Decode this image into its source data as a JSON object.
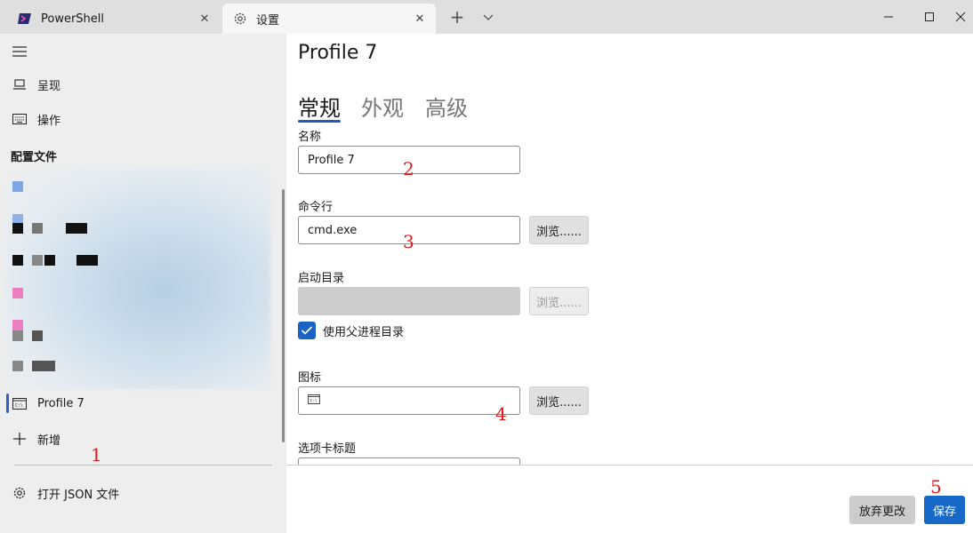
{
  "tabs": [
    {
      "label": "PowerShell",
      "icon": "powershell-icon"
    },
    {
      "label": "设置",
      "icon": "gear-icon"
    }
  ],
  "sidebar": {
    "items": [
      {
        "label": "呈现",
        "icon": "display-icon"
      },
      {
        "label": "操作",
        "icon": "keyboard-icon"
      }
    ],
    "profiles_header": "配置文件",
    "selected_profile": {
      "label": "Profile 7",
      "icon": "terminal-icon"
    },
    "add_label": "新增",
    "open_json_label": "打开 JSON 文件"
  },
  "main": {
    "title": "Profile 7",
    "tabs": [
      "常规",
      "外观",
      "高级"
    ],
    "name_label": "名称",
    "name_value": "Profile 7",
    "commandline_label": "命令行",
    "commandline_value": "cmd.exe",
    "browse_label": "浏览......",
    "startdir_label": "启动目录",
    "startdir_value": "",
    "use_parent_label": "使用父进程目录",
    "use_parent_checked": true,
    "icon_label": "图标",
    "tabtitle_label": "选项卡标题",
    "discard_label": "放弃更改",
    "save_label": "保存"
  },
  "annotations": [
    "1",
    "2",
    "3",
    "4",
    "5"
  ],
  "colors": {
    "accent": "#1669c9",
    "annotation": "#e01818"
  }
}
